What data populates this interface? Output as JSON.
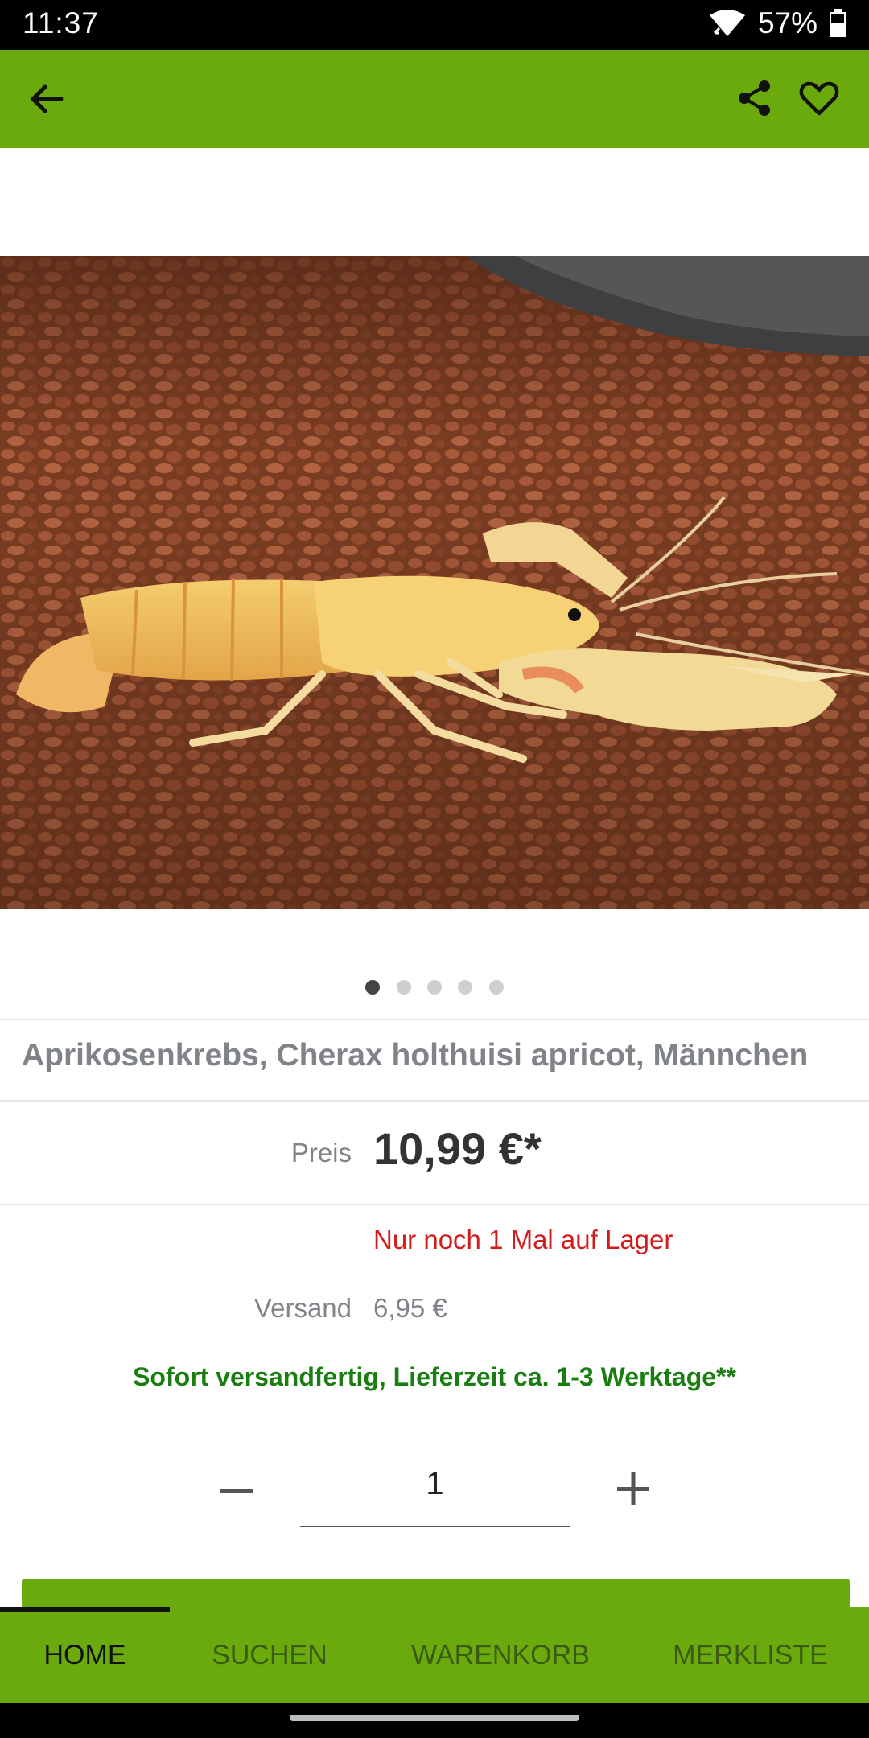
{
  "status_bar": {
    "time": "11:37",
    "battery": "57%"
  },
  "app_bar": {
    "icons": [
      "back-arrow-icon",
      "share-icon",
      "heart-icon"
    ]
  },
  "gallery": {
    "image": "apricot crayfish on brown gravel",
    "page_count": 5,
    "current_page": 1
  },
  "product": {
    "title": "Aprikosenkrebs, Cherax holthuisi apricot, Männchen",
    "price_label": "Preis",
    "price": "10,99 €*",
    "stock_note": "Nur noch 1 Mal auf Lager",
    "shipping_label": "Versand",
    "shipping_value": "6,95 €",
    "delivery_note": "Sofort versandfertig, Lieferzeit ca. 1-3 Werktage**"
  },
  "quantity": {
    "value": "1",
    "minus": "−",
    "plus": "+"
  },
  "bottom_nav": {
    "tabs": [
      {
        "label": "HOME",
        "active": true
      },
      {
        "label": "SUCHEN",
        "active": false
      },
      {
        "label": "WARENKORB",
        "active": false
      },
      {
        "label": "MERKLISTE",
        "active": false
      }
    ]
  },
  "colors": {
    "brand": "#6aaa0c",
    "price": "#333333",
    "stock": "#d01c1c",
    "delivery": "#1a7d10"
  }
}
